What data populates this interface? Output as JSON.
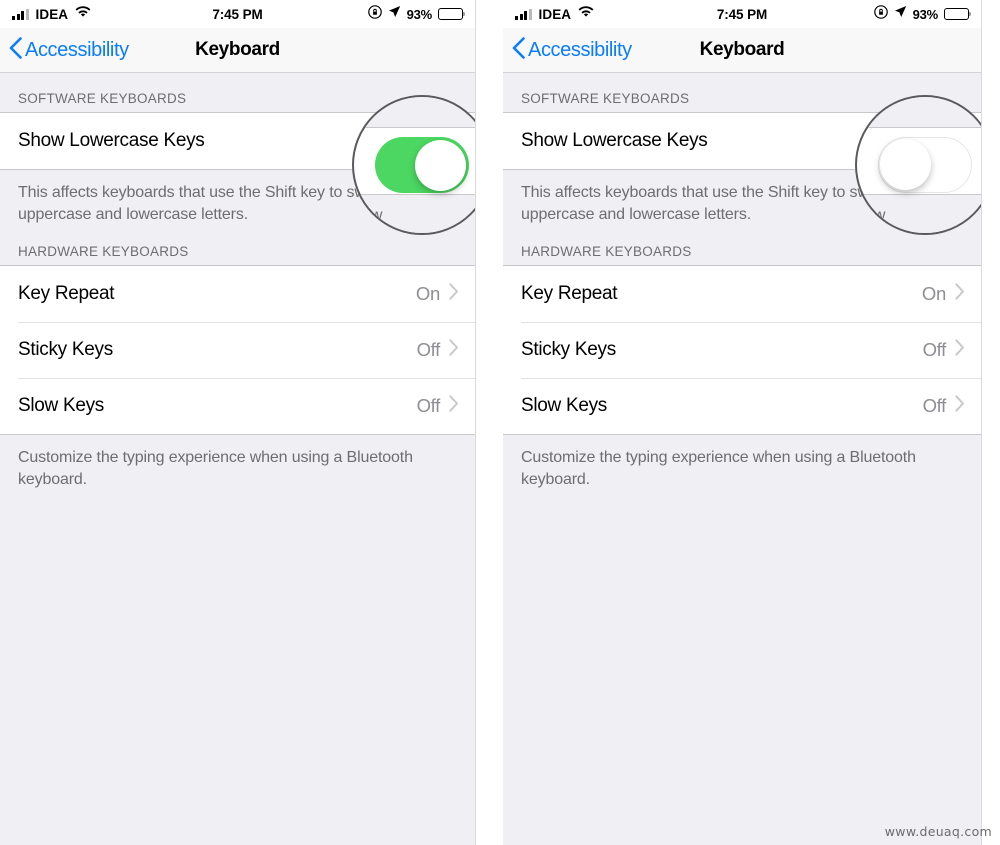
{
  "status_bar": {
    "carrier": "IDEA",
    "time": "7:45 PM",
    "battery_percent": "93%",
    "signal_icon": "cellular-signal-icon",
    "wifi_icon": "wifi-icon",
    "orientation_lock_icon": "portrait-orientation-lock-icon",
    "location_icon": "location-arrow-icon",
    "battery_icon": "battery-icon"
  },
  "nav": {
    "back_label": "Accessibility",
    "title": "Keyboard",
    "back_icon": "chevron-left-icon"
  },
  "sections": [
    {
      "header": "SOFTWARE KEYBOARDS",
      "rows": [
        {
          "label": "Show Lowercase Keys",
          "control": "switch"
        }
      ],
      "footer": "This affects keyboards that use the Shift key to switch between uppercase and lowercase letters."
    },
    {
      "header": "HARDWARE KEYBOARDS",
      "rows": [
        {
          "label": "Key Repeat",
          "value": "On",
          "control": "disclosure"
        },
        {
          "label": "Sticky Keys",
          "value": "Off",
          "control": "disclosure"
        },
        {
          "label": "Slow Keys",
          "value": "Off",
          "control": "disclosure"
        }
      ],
      "footer": "Customize the typing experience when using a Bluetooth keyboard."
    }
  ],
  "panels": [
    {
      "id": "left",
      "switch_state": "on",
      "magnifier_clipped_text": "o sw"
    },
    {
      "id": "right",
      "switch_state": "off",
      "magnifier_clipped_text": "o sw"
    }
  ],
  "colors": {
    "accent_blue": "#0a7cff",
    "switch_on_green": "#4cd964",
    "background": "#efeff4",
    "row_background": "#ffffff",
    "secondary_text": "#6d6d72",
    "magnifier_border": "#5a5a5e"
  },
  "watermark": "www.deuaq.com"
}
